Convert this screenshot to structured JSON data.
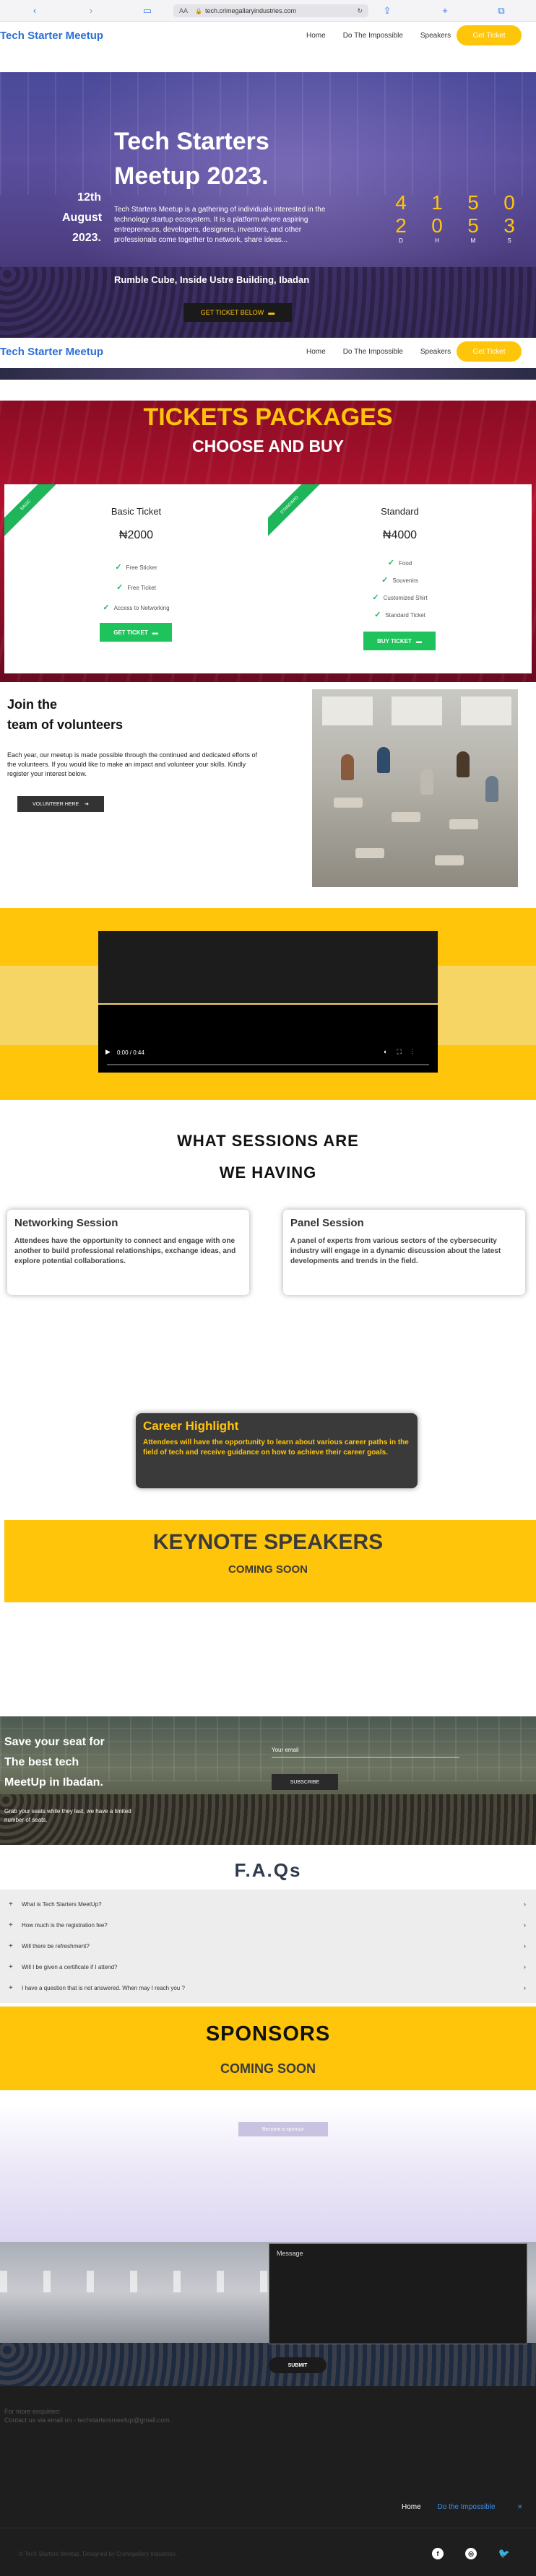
{
  "browser": {
    "url": "tech.crimegallaryindustries.com",
    "text_size": "AA"
  },
  "nav": {
    "brand": "Tech Starter Meetup",
    "links": [
      "Home",
      "Do The Impossible",
      "Speakers"
    ],
    "ticket_button": "Get Ticket"
  },
  "hero": {
    "title_line1": "Tech Starters",
    "title_line2": "Meetup 2023.",
    "date_day": "12th",
    "date_month": "August",
    "date_year": "2023.",
    "description": "Tech Starters Meetup is a gathering of individuals interested in the technology startup ecosystem. It is a platform where aspiring entrepreneurs, developers, designers, investors, and other professionals come together to network, share ideas...",
    "venue": "Rumble Cube, Inside Ustre Building, Ibadan",
    "cta": "GET TICKET BELOW",
    "countdown": [
      {
        "digits": "4",
        "label": "D"
      },
      {
        "digits": "1",
        "label": "H"
      },
      {
        "digits": "5",
        "label": "M"
      },
      {
        "digits": "0",
        "label": "S"
      }
    ],
    "countdown_row2": [
      "2",
      "0",
      "5",
      "3"
    ]
  },
  "tickets": {
    "heading": "TICKETS PACKAGES",
    "subheading": "CHOOSE AND BUY",
    "packages": [
      {
        "ribbon": "BASIC",
        "name": "Basic Ticket",
        "price": "₦2000",
        "features": [
          "Free Sticker",
          "Free Ticket",
          "Access to Networking"
        ],
        "button": "GET TICKET"
      },
      {
        "ribbon": "STANDARD",
        "name": "Standard",
        "price": "₦4000",
        "features": [
          "Food",
          "Souvenirs",
          "Customized Shirt",
          "Standard Ticket"
        ],
        "button": "BUY TICKET"
      }
    ]
  },
  "volunteers": {
    "title_line1": "Join the",
    "title_line2": "team of volunteers",
    "text": "Each year, our meetup is made possible through the continued and dedicated efforts of the volunteers. If you would like to make an impact and volunteer your skills. Kindly register your interest below.",
    "button": "VOLUNTEER HERE"
  },
  "video": {
    "time": "0:00 / 0:44"
  },
  "sessions": {
    "heading_line1": "WHAT SESSIONS ARE",
    "heading_line2": "WE HAVING",
    "cards": [
      {
        "title": "Networking Session",
        "text": "Attendees have the opportunity to connect and engage with one another to build professional relationships, exchange ideas, and explore potential collaborations."
      },
      {
        "title": "Panel Session",
        "text": "A panel of experts from various sectors of the cybersecurity industry will engage in a dynamic discussion about the latest developments and trends in the field."
      }
    ],
    "career": {
      "title": "Career Highlight",
      "text": "Attendees will have the opportunity to learn about various career paths in the field of tech and receive guidance on how to achieve their career goals."
    }
  },
  "keynote": {
    "title": "KEYNOTE SPEAKERS",
    "subtitle": "COMING SOON"
  },
  "subscribe": {
    "title_line1": "Save your seat for",
    "title_line2": "The best tech",
    "title_line3": "MeetUp in Ibadan.",
    "subtext": "Grab your seats while they last, we have a limited number of seats.",
    "email_label": "Your email",
    "button": "SUBSCRIBE"
  },
  "faq": {
    "heading": "F.A.Qs",
    "items": [
      "What is Tech Starters MeetUp?",
      "How much is the registration fee?",
      "Will there be refreshment?",
      "Will I be given a certificate if I attend?",
      "I have a question that is not answered. When may I reach you ?"
    ]
  },
  "sponsors": {
    "title": "SPONSORS",
    "subtitle": "COMING SOON",
    "button": "Become a sponsor"
  },
  "contact": {
    "message_placeholder": "Message",
    "submit": "SUBMIT"
  },
  "footer": {
    "line1": "For more enquiries:",
    "line2": "Contact us via email on - techstartersmeetup@gmail.com",
    "nav_home": "Home",
    "nav_impossible": "Do the Impossible",
    "nav_close": "✕",
    "copyright": "© Tech Starters Meetup. Designed by Crimegallery Industries.",
    "social": [
      "f",
      "◎",
      "🐦"
    ]
  },
  "colors": {
    "accent_yellow": "#ffc50a",
    "brand_blue": "#2b6fd6",
    "ticket_green": "#1fc35c",
    "dark": "#1e1e1e"
  }
}
